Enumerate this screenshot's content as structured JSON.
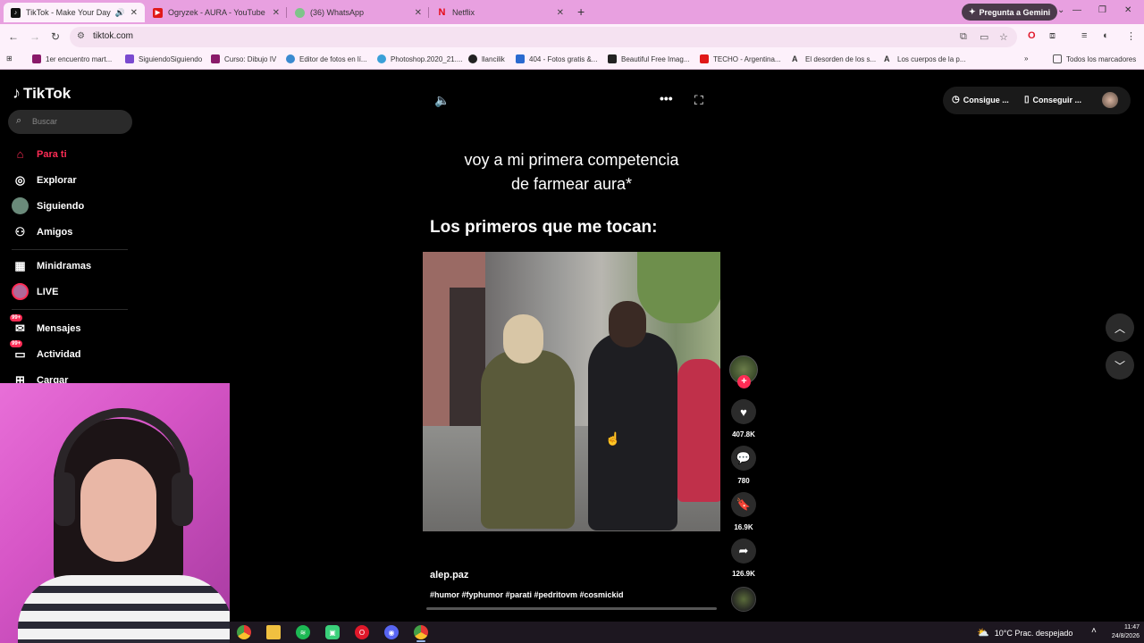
{
  "browser": {
    "tabs": [
      {
        "title": "TikTok - Make Your Day",
        "active": true
      },
      {
        "title": "Ogryzek - AURA - YouTube",
        "active": false
      },
      {
        "title": "(36) WhatsApp",
        "active": false
      },
      {
        "title": "Netflix",
        "active": false
      }
    ],
    "gemini_label": "Pregunta a Gemini",
    "url": "tiktok.com",
    "bookmarks": [
      "1er encuentro mart...",
      "SiguiendoSiguiendo",
      "Curso: Dibujo IV",
      "Editor de fotos en lí...",
      "Photoshop.2020_21....",
      "llancilik",
      "404 - Fotos gratis &...",
      "Beautiful Free Imag...",
      "TECHO - Argentina...",
      "El desorden de los s...",
      "Los cuerpos de la p..."
    ],
    "all_bookmarks_label": "Todos los marcadores"
  },
  "tiktok": {
    "logo": "TikTok",
    "search_placeholder": "Buscar",
    "nav": [
      {
        "label": "Para ti",
        "icon": "home-icon"
      },
      {
        "label": "Explorar",
        "icon": "compass-icon"
      },
      {
        "label": "Siguiendo",
        "icon": "following-avatar-icon"
      },
      {
        "label": "Amigos",
        "icon": "friends-icon"
      },
      {
        "label": "Minidramas",
        "icon": "film-icon"
      },
      {
        "label": "LIVE",
        "icon": "live-icon"
      },
      {
        "label": "Mensajes",
        "icon": "messages-icon",
        "badge": "99+"
      },
      {
        "label": "Actividad",
        "icon": "activity-icon",
        "badge": "99+"
      },
      {
        "label": "Cargar",
        "icon": "upload-icon"
      }
    ],
    "video": {
      "caption_line1": "voy a mi primera competencia",
      "caption_line2": "de farmear aura*",
      "caption_sub": "Los primeros que me tocan:",
      "author": "alep.paz",
      "hashtags": "#humor #fyphumor #parati #pedritovm #cosmickid",
      "progress": 0
    },
    "actions": {
      "likes": "407.8K",
      "comments": "780",
      "saves": "16.9K",
      "shares": "126.9K"
    },
    "topright": {
      "coins_label": "Consigue ...",
      "app_label": "Conseguir ..."
    }
  },
  "taskbar": {
    "weather": "10°C  Prac. despejado",
    "time": "11:47",
    "date": "24/8/2026"
  }
}
